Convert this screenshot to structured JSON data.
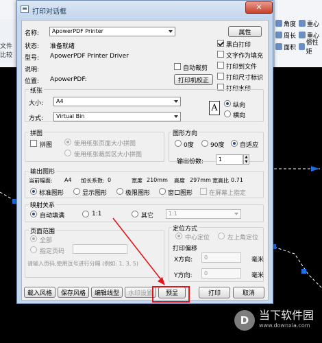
{
  "background": {
    "ribbon_right": [
      {
        "label": "角度",
        "row": 0,
        "col": 0
      },
      {
        "label": "重心",
        "row": 0,
        "col": 1
      },
      {
        "label": "周长",
        "row": 1,
        "col": 0
      },
      {
        "label": "重心",
        "row": 1,
        "col": 1
      },
      {
        "label": "面积",
        "row": 2,
        "col": 0
      },
      {
        "label": "惯性矩",
        "row": 2,
        "col": 1
      }
    ],
    "ribbon_left_text": "文件比较",
    "watermark_title": "当下软件园",
    "watermark_url": "www.downxia.com"
  },
  "dialog": {
    "title": "打印对话框",
    "close_label": "✕",
    "printer": {
      "name_label": "名称:",
      "name_value": "ApowerPDF Printer",
      "properties_button": "属性",
      "status_label": "状态:",
      "status_value": "准备就绪",
      "type_label": "型号:",
      "type_value": "ApowerPDF Printer Driver",
      "comment_label": "说明:",
      "where_label": "位置:",
      "where_value": "ApowerPDF:",
      "auto_crop_label": "自动裁剪",
      "calibrate_button": "打印机校正"
    },
    "options": [
      {
        "label": "黑白打印",
        "checked": true
      },
      {
        "label": "文字作为填充",
        "checked": false
      },
      {
        "label": "打印到文件",
        "checked": false
      },
      {
        "label": "打印尺寸标识",
        "checked": false
      },
      {
        "label": "打印水印",
        "checked": false
      }
    ],
    "paper": {
      "group_label": "纸张",
      "size_label": "大小:",
      "size_value": "A4",
      "source_label": "方式:",
      "source_value": "Virtual Bin",
      "orientation_icon_letter": "A",
      "portrait_label": "纵向",
      "landscape_label": "横向",
      "orientation": "portrait"
    },
    "tiling": {
      "group_label": "拼图",
      "tile_label": "拼图",
      "option1": "使用纸张页面大小拼图",
      "option2": "使用纸张裁剪区大小拼图"
    },
    "direction": {
      "group_label": "图形方向",
      "options": [
        "0度",
        "90度",
        "自适应"
      ],
      "selected": "自适应",
      "copies_label": "输出份数:",
      "copies_value": "1"
    },
    "output": {
      "group_label": "输出图形",
      "info": [
        {
          "label": "当前幅面:",
          "value": "A4"
        },
        {
          "label": "加长系数:",
          "value": "0"
        },
        {
          "label": "宽度",
          "value": "210mm"
        },
        {
          "label": "高度",
          "value": "297mm"
        },
        {
          "label": "宽高比",
          "value": "0.71"
        }
      ],
      "options": [
        "标准图形",
        "显示图形",
        "极限图形",
        "窗口图形"
      ],
      "selected": "标准图形",
      "on_screen_label": "在屏幕上指定"
    },
    "mapping": {
      "group_label": "映射关系",
      "auto_fill_label": "自动填满",
      "one_to_one_label": "1:1",
      "other_label": "其它",
      "ratio_value": "1:1",
      "selected": "自动填满"
    },
    "page_range": {
      "group_label": "页面范围",
      "all_label": "全部",
      "specify_label": "指定页码",
      "hint": "请输入页码,使用逗号进行分隔 (例如: 1, 3, 5)"
    },
    "positioning": {
      "group_label": "定位方式",
      "center_label": "中心定位",
      "top_left_label": "左上角定位",
      "offset_label": "打印偏移",
      "x_label": "X方向:",
      "x_value": "0",
      "y_label": "Y方向:",
      "y_value": "0",
      "unit": "毫米"
    },
    "buttons": {
      "load_style": "载入风格",
      "save_style": "保存风格",
      "edit_linetype": "编辑线型",
      "watermark_settings": "水印设置",
      "preview": "预显",
      "print": "打印",
      "cancel": "取消"
    },
    "accent_colors": {
      "highlight": "#e6131b",
      "titlebar": "#c4d6ec",
      "close": "#c7402a"
    }
  }
}
